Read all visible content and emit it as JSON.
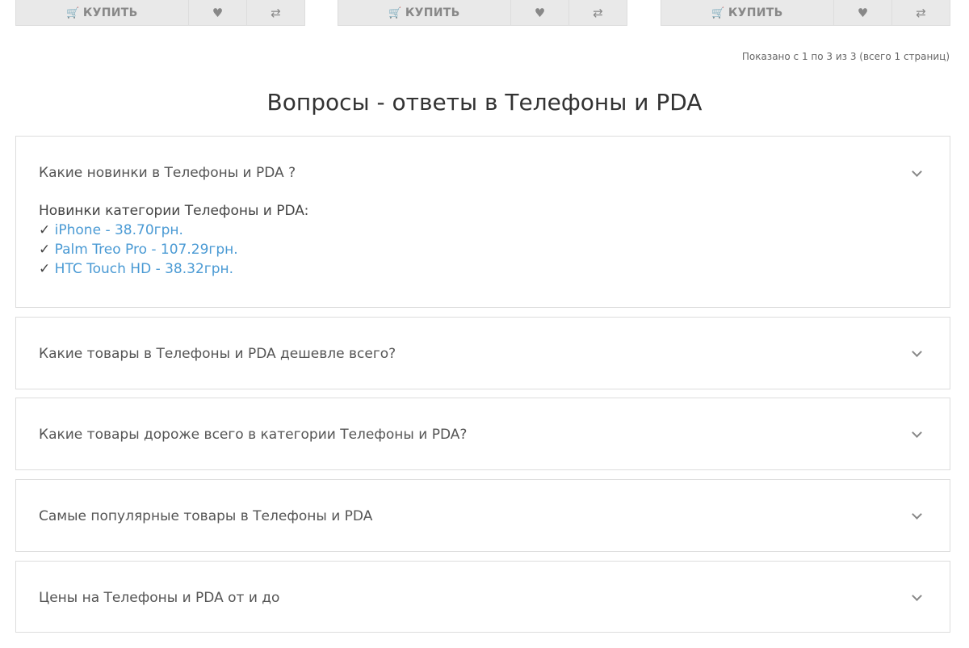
{
  "products": [
    {
      "buy_label": "КУПИТЬ"
    },
    {
      "buy_label": "КУПИТЬ"
    },
    {
      "buy_label": "КУПИТЬ"
    }
  ],
  "pagination_info": "Показано с 1 по 3 из 3 (всего 1 страниц)",
  "faq": {
    "title": "Вопросы - ответы в Телефоны и PDA",
    "items": [
      {
        "question": "Какие новинки в Телефоны и PDA ?",
        "answer_intro": "Новинки категории Телефоны и PDA:",
        "answer_links": [
          {
            "mark": "✓",
            "text": "iPhone - 38.70грн."
          },
          {
            "mark": "✓",
            "text": "Palm Treo Pro - 107.29грн."
          },
          {
            "mark": "✓",
            "text": "HTC Touch HD - 38.32грн."
          }
        ]
      },
      {
        "question": "Какие товары в Телефоны и PDA дешевле всего?"
      },
      {
        "question": "Какие товары дороже всего в категории Телефоны и PDA?"
      },
      {
        "question": "Самые популярные товары в Телефоны и PDA"
      },
      {
        "question": "Цены на Телефоны и PDA от и до"
      }
    ]
  },
  "colors": {
    "link": "#4a9ad4",
    "border": "#dddddd",
    "button_bg": "#e9e9e9"
  }
}
